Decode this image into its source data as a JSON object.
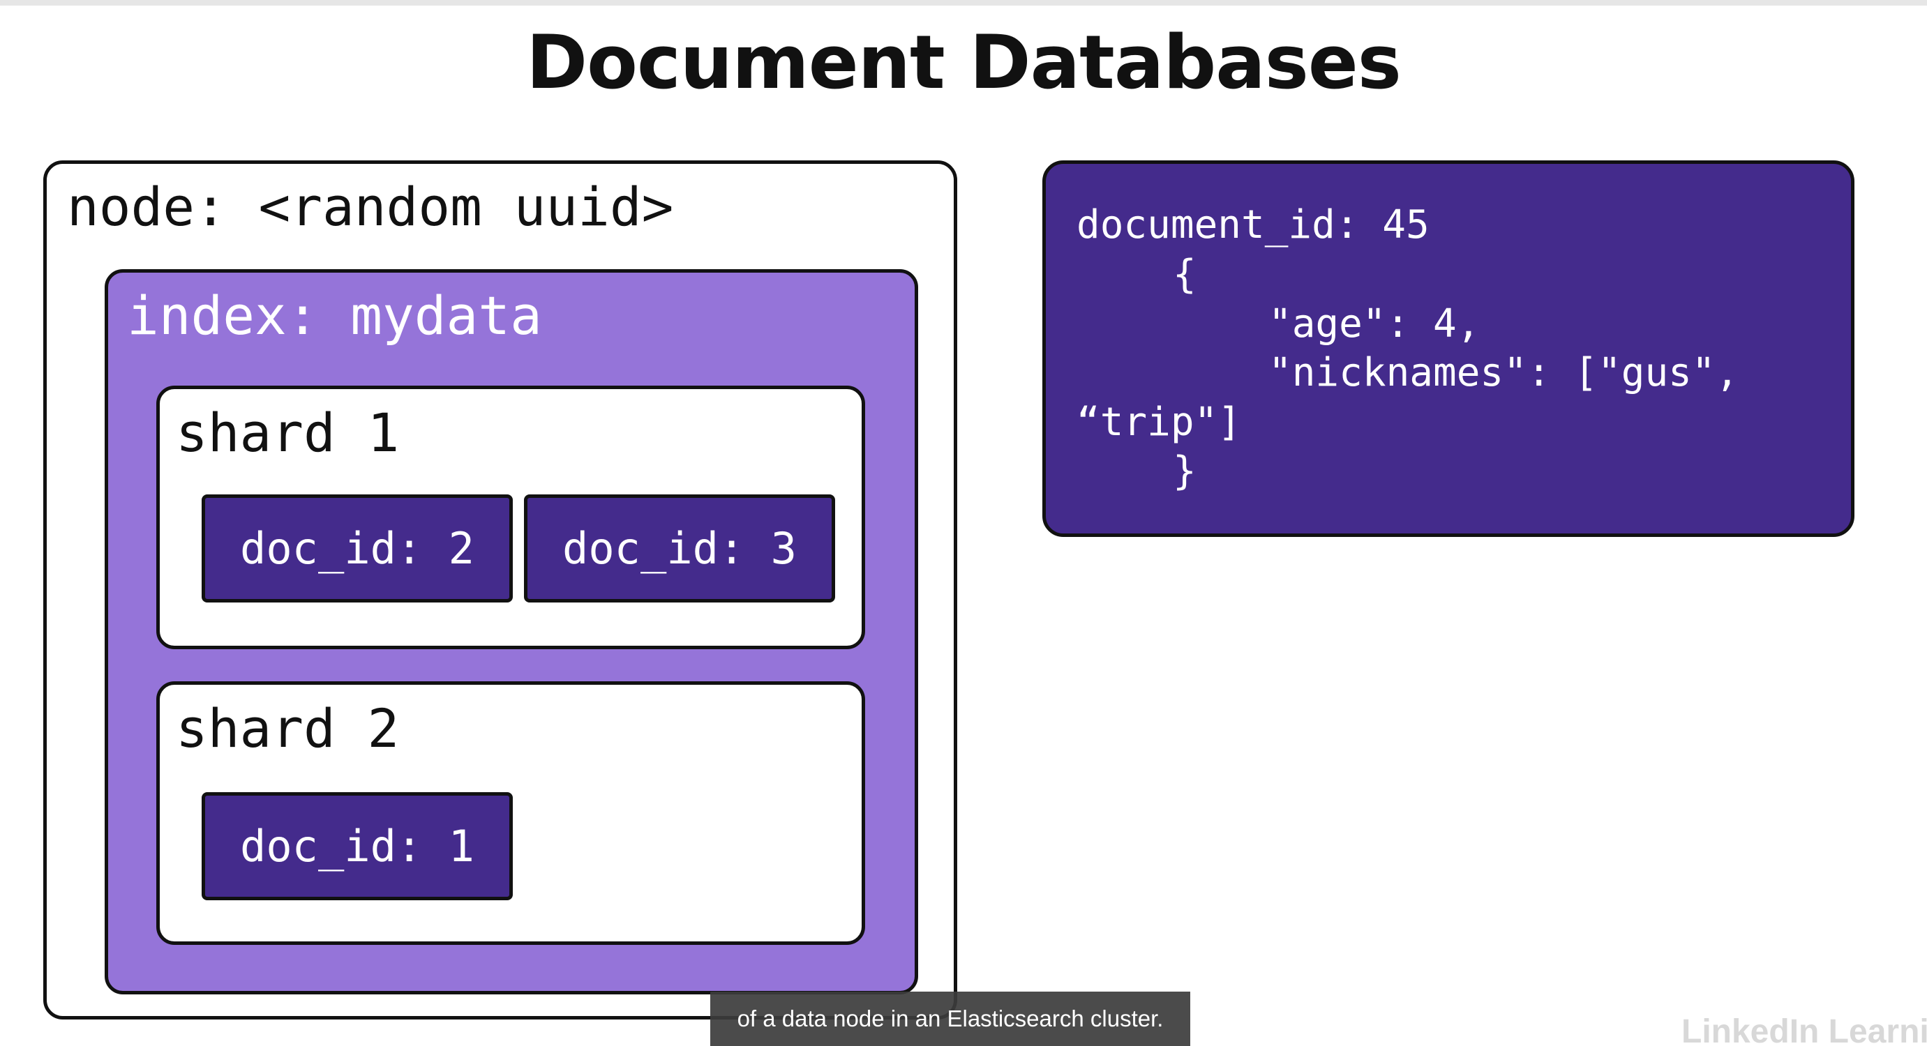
{
  "title": "Document Databases",
  "node": {
    "label": "node: <random uuid>",
    "index": {
      "label": "index: mydata",
      "shards": [
        {
          "label": "shard 1",
          "docs": [
            "doc_id: 2",
            "doc_id: 3"
          ]
        },
        {
          "label": "shard 2",
          "docs": [
            "doc_id: 1"
          ]
        }
      ]
    }
  },
  "document": {
    "lines": [
      "document_id: 45",
      "{",
      "\"age\": 4,",
      "\"nicknames\": [\"gus\",",
      "“trip\"]",
      "}"
    ]
  },
  "caption": "of a data node in an Elasticsearch cluster.",
  "watermark": "LinkedIn Learning",
  "colors": {
    "index_fill": "#9574d9",
    "doc_fill": "#442b8c",
    "outline": "#111111"
  }
}
